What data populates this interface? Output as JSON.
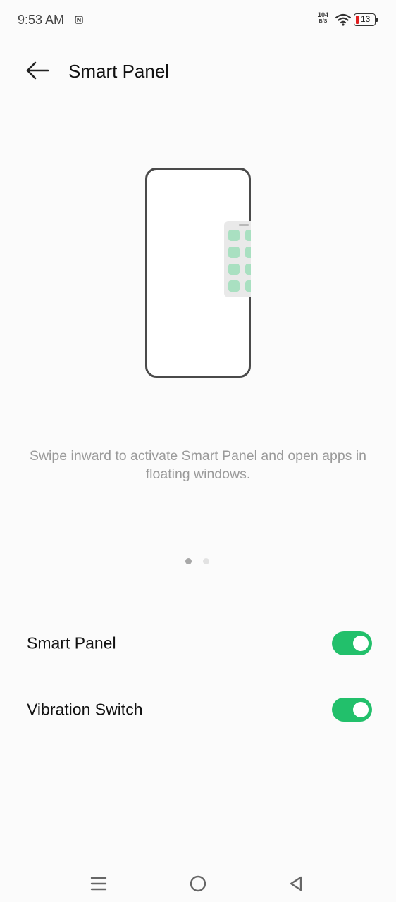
{
  "status_bar": {
    "time": "9:53 AM",
    "net_speed_value": "104",
    "net_speed_unit": "B/S",
    "battery_level": "13",
    "icons": [
      "nfc-icon",
      "wifi-icon",
      "battery-icon"
    ]
  },
  "header": {
    "title": "Smart Panel",
    "back_icon": "arrow-left-icon"
  },
  "illustration": {
    "description": "Swipe inward to activate Smart Panel and open apps in floating windows.",
    "pages_total": 2,
    "current_page": 1
  },
  "settings": [
    {
      "label": "Smart Panel",
      "enabled": true
    },
    {
      "label": "Vibration Switch",
      "enabled": true
    }
  ],
  "nav_bar": {
    "icons": [
      "menu-icon",
      "home-icon",
      "back-triangle-icon"
    ]
  },
  "colors": {
    "accent_toggle": "#22c06b",
    "panel_app": "#a9e0c1",
    "battery_low": "#e02020"
  }
}
